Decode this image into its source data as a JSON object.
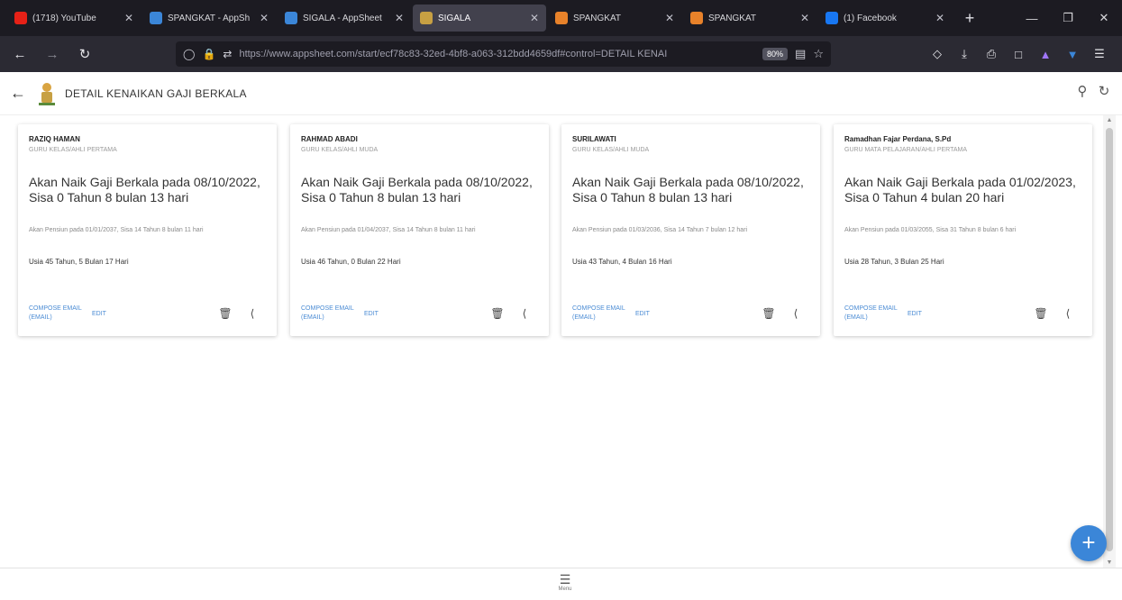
{
  "browser": {
    "tabs": [
      {
        "label": "(1718) YouTube",
        "favicon_color": "#e62117"
      },
      {
        "label": "SPANGKAT - AppSh",
        "favicon_color": "#3b86d8"
      },
      {
        "label": "SIGALA - AppSheet",
        "favicon_color": "#3b86d8"
      },
      {
        "label": "SIGALA",
        "favicon_color": "#c7a043"
      },
      {
        "label": "SPANGKAT",
        "favicon_color": "#e8822a"
      },
      {
        "label": "SPANGKAT",
        "favicon_color": "#e8822a"
      },
      {
        "label": "(1) Facebook",
        "favicon_color": "#1877f2"
      }
    ],
    "url": "https://www.appsheet.com/start/ecf78c83-32ed-4bf8-a063-312bdd4659df#control=DETAIL KENAI",
    "zoom": "80%"
  },
  "app": {
    "title": "DETAIL KENAIKAN GAJI BERKALA",
    "menu_label": "Menu"
  },
  "cards": [
    {
      "name": "RAZIQ HAMAN",
      "subtitle": "GURU KELAS/AHLI PERTAMA",
      "headline": "Akan Naik Gaji Berkala pada 08/10/2022, Sisa 0 Tahun 8 bulan 13 hari",
      "note": "Akan Pensiun pada 01/01/2037, Sisa 14 Tahun 8 bulan 11 hari",
      "age": "Usia 45 Tahun, 5 Bulan 17 Hari",
      "compose": "COMPOSE EMAIL (EMAIL)",
      "edit": "EDIT"
    },
    {
      "name": "RAHMAD ABADI",
      "subtitle": "GURU KELAS/AHLI MUDA",
      "headline": "Akan Naik Gaji Berkala pada 08/10/2022, Sisa 0 Tahun 8 bulan 13 hari",
      "note": "Akan Pensiun pada 01/04/2037, Sisa 14 Tahun 8 bulan 11 hari",
      "age": "Usia 46 Tahun, 0 Bulan 22 Hari",
      "compose": "COMPOSE EMAIL (EMAIL)",
      "edit": "EDIT"
    },
    {
      "name": "SURILAWATI",
      "subtitle": "GURU KELAS/AHLI MUDA",
      "headline": "Akan Naik Gaji Berkala pada 08/10/2022, Sisa 0 Tahun 8 bulan 13 hari",
      "note": "Akan Pensiun pada 01/03/2036, Sisa 14 Tahun 7 bulan 12 hari",
      "age": "Usia 43 Tahun, 4 Bulan 16 Hari",
      "compose": "COMPOSE EMAIL (EMAIL)",
      "edit": "EDIT"
    },
    {
      "name": "Ramadhan Fajar Perdana, S.Pd",
      "subtitle": "GURU MATA PELAJARAN/AHLI PERTAMA",
      "headline": "Akan Naik Gaji Berkala pada 01/02/2023, Sisa 0 Tahun 4 bulan 20 hari",
      "note": "Akan Pensiun pada 01/03/2055, Sisa 31 Tahun 8 bulan 6 hari",
      "age": "Usia 28 Tahun, 3 Bulan 25 Hari",
      "compose": "COMPOSE EMAIL (EMAIL)",
      "edit": "EDIT"
    }
  ]
}
